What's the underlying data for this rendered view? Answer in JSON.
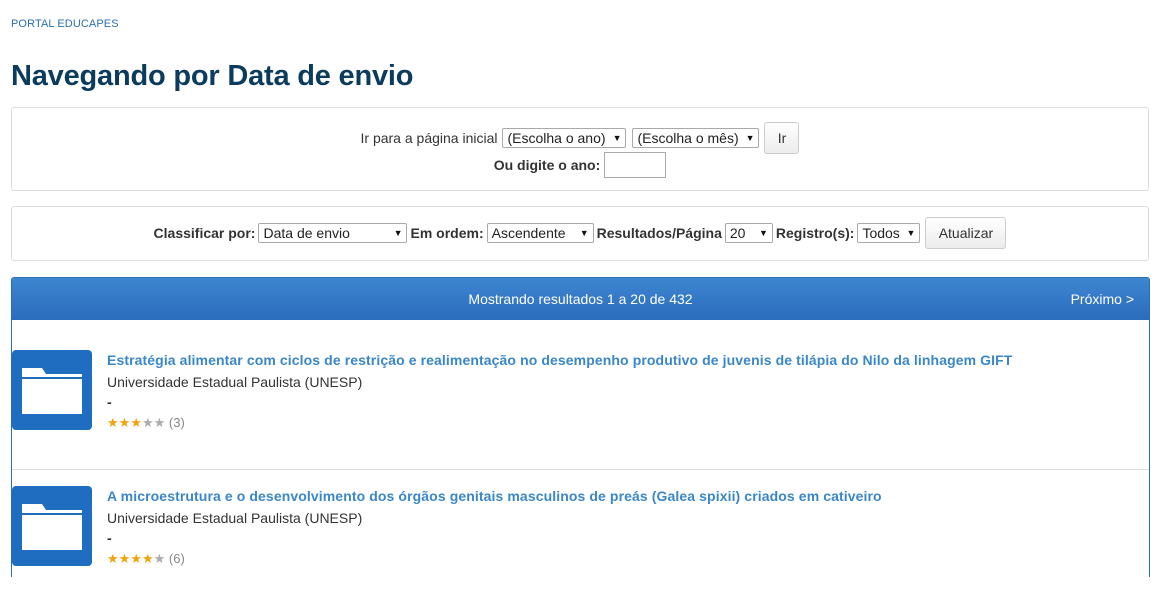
{
  "breadcrumb": "PORTAL EDUCAPES",
  "page_title": "Navegando por Data de envio",
  "jump": {
    "label": "Ir para a página inicial",
    "year_select": "(Escolha o ano)",
    "month_select": "(Escolha o mês)",
    "go_button": "Ir",
    "year_input_label": "Ou digite o ano:",
    "year_input_value": ""
  },
  "sort": {
    "sort_by_label": "Classificar por:",
    "sort_by_value": "Data de envio",
    "order_label": "Em ordem:",
    "order_value": "Ascendente",
    "per_page_label": "Resultados/Página",
    "per_page_value": "20",
    "records_label": "Registro(s):",
    "records_value": "Todos",
    "update_button": "Atualizar"
  },
  "results": {
    "count_text": "Mostrando resultados 1 a 20 de 432",
    "next_label": "Próximo >",
    "items": [
      {
        "title": "Estratégia alimentar com ciclos de restrição e realimentação no desempenho produtivo de juvenis de tilápia do Nilo da linhagem GIFT",
        "institution": "Universidade Estadual Paulista (UNESP)",
        "author": "-",
        "rating": 3,
        "rating_count": "(3)"
      },
      {
        "title": "A microestrutura e o desenvolvimento dos órgãos genitais masculinos de preás (Galea spixii) criados em cativeiro",
        "institution": "Universidade Estadual Paulista (UNESP)",
        "author": "-",
        "rating": 4,
        "rating_count": "(6)"
      }
    ]
  },
  "colors": {
    "title": "#0b3c5d",
    "link": "#3a87c8",
    "header_bar": "#2a6cbd",
    "star": "#f0a30a"
  },
  "icons": {
    "thumbnail": "folder-icon",
    "select_arrow": "caret-down-icon",
    "rating": "star-icon"
  }
}
